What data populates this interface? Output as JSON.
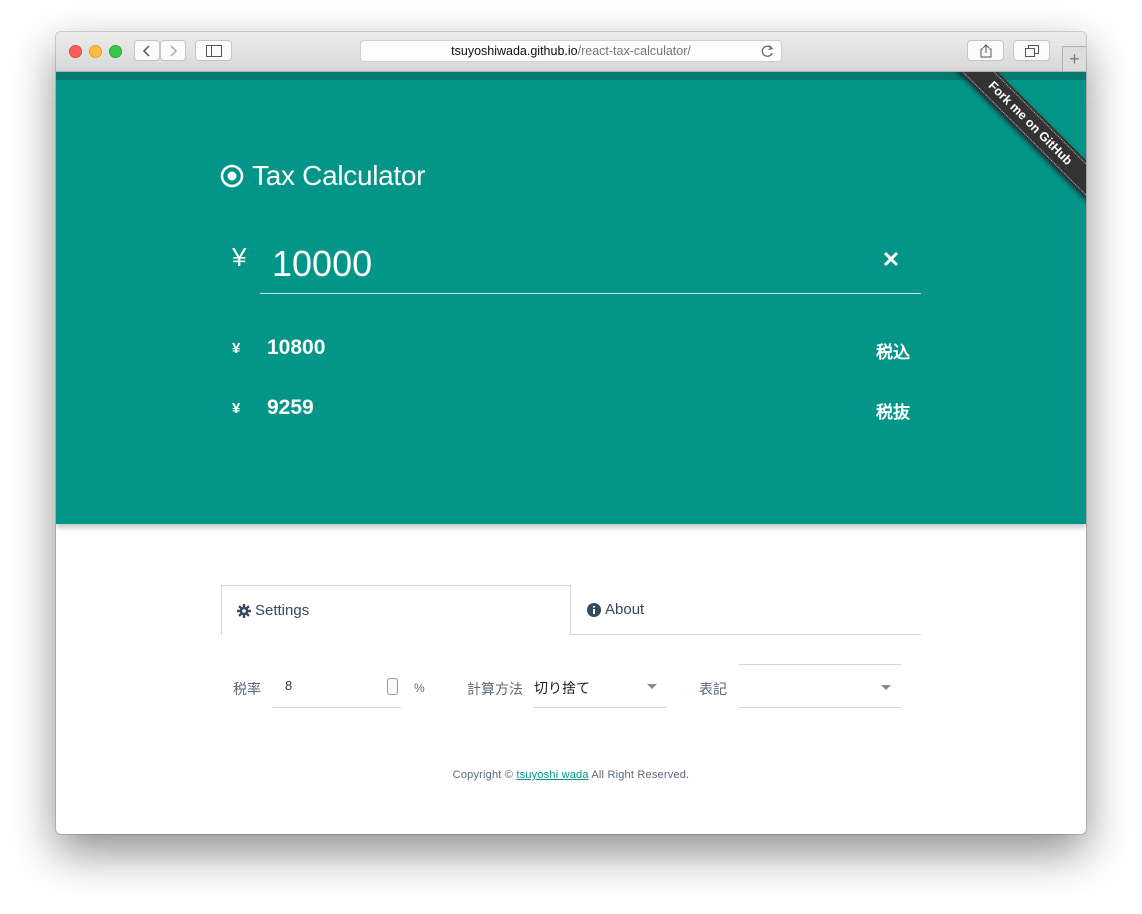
{
  "browser": {
    "url_host": "tsuyoshiwada.github.io",
    "url_path": "/react-tax-calculator/"
  },
  "app": {
    "title": "Tax Calculator",
    "currency_symbol": "¥",
    "amount_value": "10000",
    "results": [
      {
        "symbol": "¥",
        "value": "10800",
        "label": "税込"
      },
      {
        "symbol": "¥",
        "value": "9259",
        "label": "税抜"
      }
    ],
    "ribbon_text": "Fork me on GitHub",
    "accent_color": "#039587"
  },
  "tabs": [
    {
      "label": "Settings",
      "icon": "gear-icon",
      "active": true
    },
    {
      "label": "About",
      "icon": "info-icon",
      "active": false
    }
  ],
  "settings": {
    "tax_rate_label": "税率",
    "tax_rate_value": "8",
    "tax_rate_unit": "%",
    "rounding_label": "計算方法",
    "rounding_value": "切り捨て",
    "notation_label": "表記",
    "notation_value": ""
  },
  "footer": {
    "prefix": "Copyright ©",
    "author": "tsuyoshi wada",
    "suffix": "All Right Reserved."
  }
}
